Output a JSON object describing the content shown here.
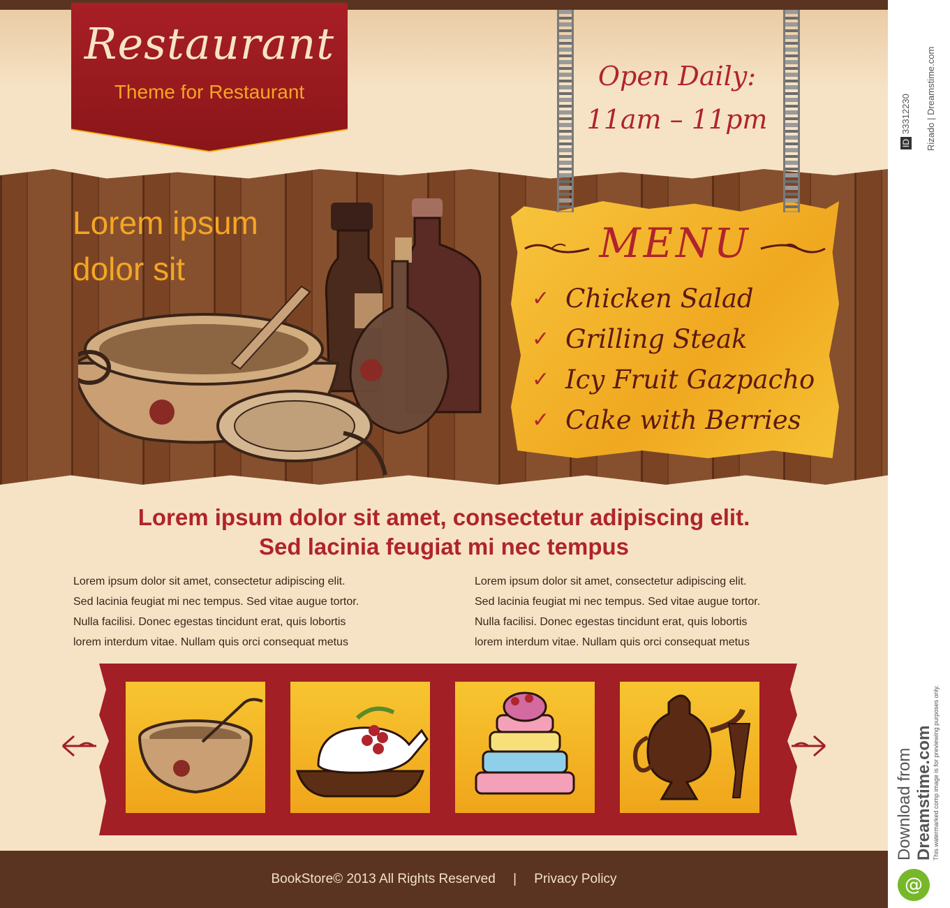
{
  "header": {
    "logo_title": "Restaurant",
    "logo_subtitle": "Theme for Restaurant",
    "hours_line1": "Open Daily:",
    "hours_line2": "11am – 11pm"
  },
  "hero": {
    "title_line1": "Lorem ipsum",
    "title_line2": "dolor sit"
  },
  "menu": {
    "title": "MENU",
    "check_glyph": "✓",
    "items": [
      "Chicken Salad",
      "Grilling Steak",
      "Icy Fruit Gazpacho",
      "Cake with Berries"
    ]
  },
  "content": {
    "headline_line1": "Lorem ipsum dolor sit amet, consectetur adipiscing elit.",
    "headline_line2": "Sed lacinia feugiat mi nec tempus",
    "col1": [
      "Lorem ipsum dolor sit amet, consectetur adipiscing elit.",
      "Sed lacinia feugiat mi nec tempus. Sed vitae augue tortor.",
      "Nulla facilisi. Donec egestas tincidunt erat, quis lobortis",
      "lorem interdum vitae. Nullam quis orci consequat metus"
    ],
    "col2": [
      "Lorem ipsum dolor sit amet, consectetur adipiscing elit.",
      "Sed lacinia feugiat mi nec tempus. Sed vitae augue tortor.",
      "Nulla facilisi. Donec egestas tincidunt erat, quis lobortis",
      "lorem interdum vitae. Nullam quis orci consequat metus"
    ]
  },
  "gallery": {
    "tiles": [
      "soup-tureen-icon",
      "roast-chicken-icon",
      "layer-cake-icon",
      "coffee-pot-icon"
    ]
  },
  "footer": {
    "copyright": "BookStore© 2013 All Rights Reserved",
    "separator": "|",
    "privacy": "Privacy Policy"
  },
  "side": {
    "id_label": "ID",
    "id_value": "33312230",
    "credit": "Rizado | Dreamstime.com",
    "download_line1": "Download from",
    "download_line2": "Dreamstime.com",
    "watermark_note": "This watermarked comp image is for previewing purposes only."
  },
  "colors": {
    "brand_red": "#a81f26",
    "accent_orange": "#f5a623",
    "wood_brown": "#7a4424",
    "cream": "#f6e3c6",
    "footer_brown": "#5a3420"
  }
}
